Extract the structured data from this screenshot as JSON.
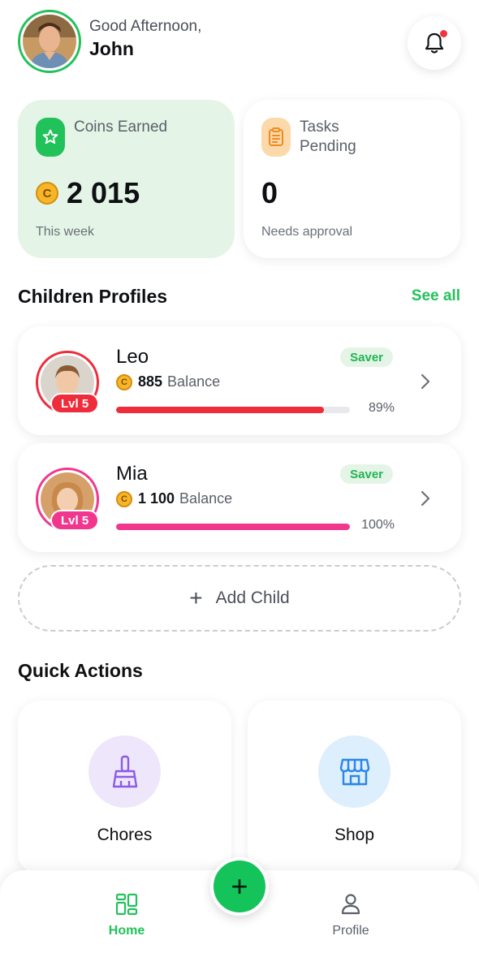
{
  "header": {
    "greeting": "Good Afternoon,",
    "name": "John"
  },
  "stats": {
    "coins": {
      "label": "Coins Earned",
      "value": "2 015",
      "sub": "This week",
      "coin_glyph": "C"
    },
    "tasks": {
      "label": "Tasks Pending",
      "value": "0",
      "sub": "Needs approval"
    }
  },
  "children_section": {
    "title": "Children Profiles",
    "see_all": "See all"
  },
  "children": [
    {
      "name": "Leo",
      "badge": "Saver",
      "balance_value": "885",
      "balance_label": "Balance",
      "level": "Lvl 5",
      "progress_text": "89%",
      "progress": 0.89,
      "color": "#ef2c3c"
    },
    {
      "name": "Mia",
      "badge": "Saver",
      "balance_value": "1 100",
      "balance_label": "Balance",
      "level": "Lvl 5",
      "progress_text": "100%",
      "progress": 1.0,
      "color": "#f0378d"
    }
  ],
  "add_child": {
    "label": "Add Child"
  },
  "quick_actions": {
    "title": "Quick Actions",
    "items": [
      {
        "label": "Chores",
        "icon": "broom-icon",
        "color": "#8c5be6"
      },
      {
        "label": "Shop",
        "icon": "storefront-icon",
        "color": "#2a86ea"
      }
    ]
  },
  "nav": {
    "home": "Home",
    "profile": "Profile",
    "fab": "+"
  },
  "colors": {
    "accent": "#22c25a",
    "alert": "#f03340"
  }
}
